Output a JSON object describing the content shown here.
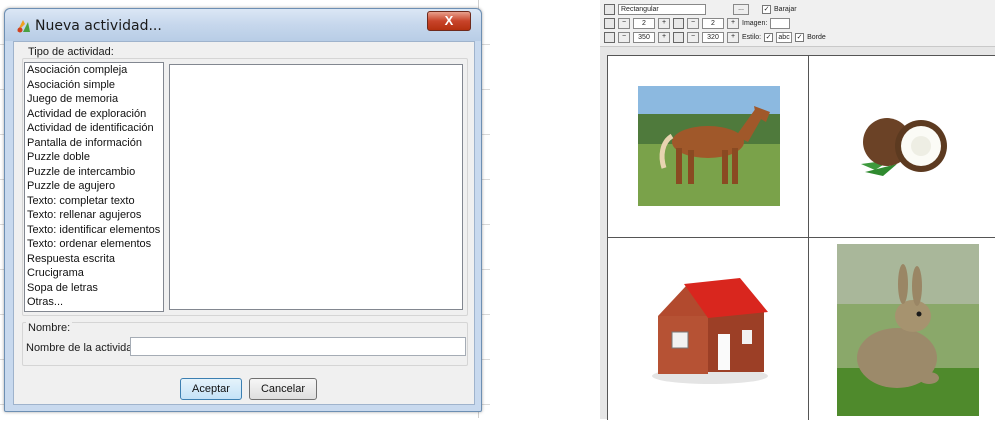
{
  "dialog": {
    "title": "Nueva actividad...",
    "close_label": "X",
    "type_section_label": "Tipo de actividad:",
    "activity_types": [
      "Asociación compleja",
      "Asociación simple",
      "Juego de memoria",
      "Actividad de exploración",
      "Actividad de identificación",
      "Pantalla de información",
      "Puzzle doble",
      "Puzzle de intercambio",
      "Puzzle de agujero",
      "Texto: completar texto",
      "Texto: rellenar agujeros",
      "Texto: identificar elementos",
      "Texto: ordenar elementos",
      "Respuesta escrita",
      "Crucigrama",
      "Sopa de letras",
      "Otras..."
    ],
    "name_section_label": "Nombre:",
    "name_field_label": "Nombre de la actividad",
    "name_value": "",
    "accept_label": "Aceptar",
    "cancel_label": "Cancelar"
  },
  "editor": {
    "shape_select": "Rectangular",
    "ellipsis": "...",
    "shuffle_label": "Barajar",
    "rows_value": "2",
    "cols_value": "2",
    "image_label": "Imagen:",
    "width_value": "350",
    "height_value": "320",
    "style_label": "Estilo:",
    "style_sample": "abc",
    "border_label": "Borde",
    "cells": [
      "horse",
      "coconut",
      "house",
      "rabbit"
    ]
  },
  "colors": {
    "dialog_frame": "#c8d9ee",
    "accent": "#3c7fb1",
    "close": "#c8442a"
  }
}
